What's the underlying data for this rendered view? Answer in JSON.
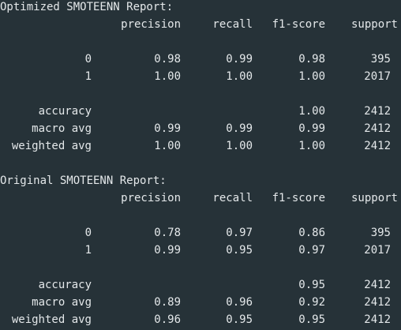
{
  "reports": [
    {
      "title": "Optimized SMOTEENN Report:",
      "header": [
        "precision",
        "recall",
        "f1-score",
        "support"
      ],
      "rows": [
        {
          "label": "0",
          "precision": "0.98",
          "recall": "0.99",
          "f1": "0.98",
          "support": "395"
        },
        {
          "label": "1",
          "precision": "1.00",
          "recall": "1.00",
          "f1": "1.00",
          "support": "2017"
        }
      ],
      "summary": [
        {
          "label": "accuracy",
          "precision": "",
          "recall": "",
          "f1": "1.00",
          "support": "2412"
        },
        {
          "label": "macro avg",
          "precision": "0.99",
          "recall": "0.99",
          "f1": "0.99",
          "support": "2412"
        },
        {
          "label": "weighted avg",
          "precision": "1.00",
          "recall": "1.00",
          "f1": "1.00",
          "support": "2412"
        }
      ]
    },
    {
      "title": "Original SMOTEENN Report:",
      "header": [
        "precision",
        "recall",
        "f1-score",
        "support"
      ],
      "rows": [
        {
          "label": "0",
          "precision": "0.78",
          "recall": "0.97",
          "f1": "0.86",
          "support": "395"
        },
        {
          "label": "1",
          "precision": "0.99",
          "recall": "0.95",
          "f1": "0.97",
          "support": "2017"
        }
      ],
      "summary": [
        {
          "label": "accuracy",
          "precision": "",
          "recall": "",
          "f1": "0.95",
          "support": "2412"
        },
        {
          "label": "macro avg",
          "precision": "0.89",
          "recall": "0.96",
          "f1": "0.92",
          "support": "2412"
        },
        {
          "label": "weighted avg",
          "precision": "0.96",
          "recall": "0.95",
          "f1": "0.95",
          "support": "2412"
        }
      ]
    }
  ]
}
